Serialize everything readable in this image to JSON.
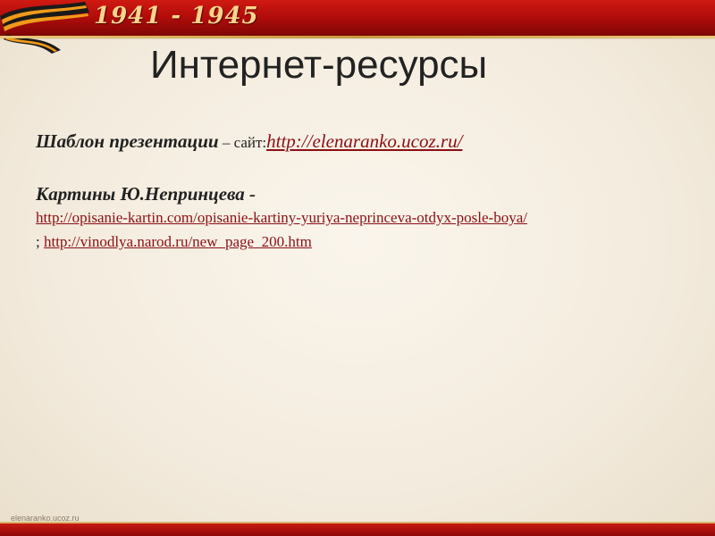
{
  "header": {
    "years": "1941 - 1945",
    "colors": {
      "banner": "#b30d0b",
      "years_text": "#f6d58d"
    },
    "ribbon_icon": "st-george-ribbon-icon"
  },
  "title": "Интернет-ресурсы",
  "line1": {
    "label": "Шаблон презентации",
    "separator": " – сайт:",
    "link": "http://elenaranko.ucoz.ru/"
  },
  "line2": {
    "label": "Картины Ю.Непринцева -",
    "link1": "http://opisanie-kartin.com/opisanie-kartiny-yuriya-neprinceva-otdyx-posle-boya/",
    "separator": "; ",
    "link2": "http://vinodlya.narod.ru/new_page_200.htm"
  },
  "footer": {
    "site": "elenaranko.ucoz.ru"
  },
  "colors": {
    "link": "#8b0f14",
    "background": "#f3ebdd"
  }
}
